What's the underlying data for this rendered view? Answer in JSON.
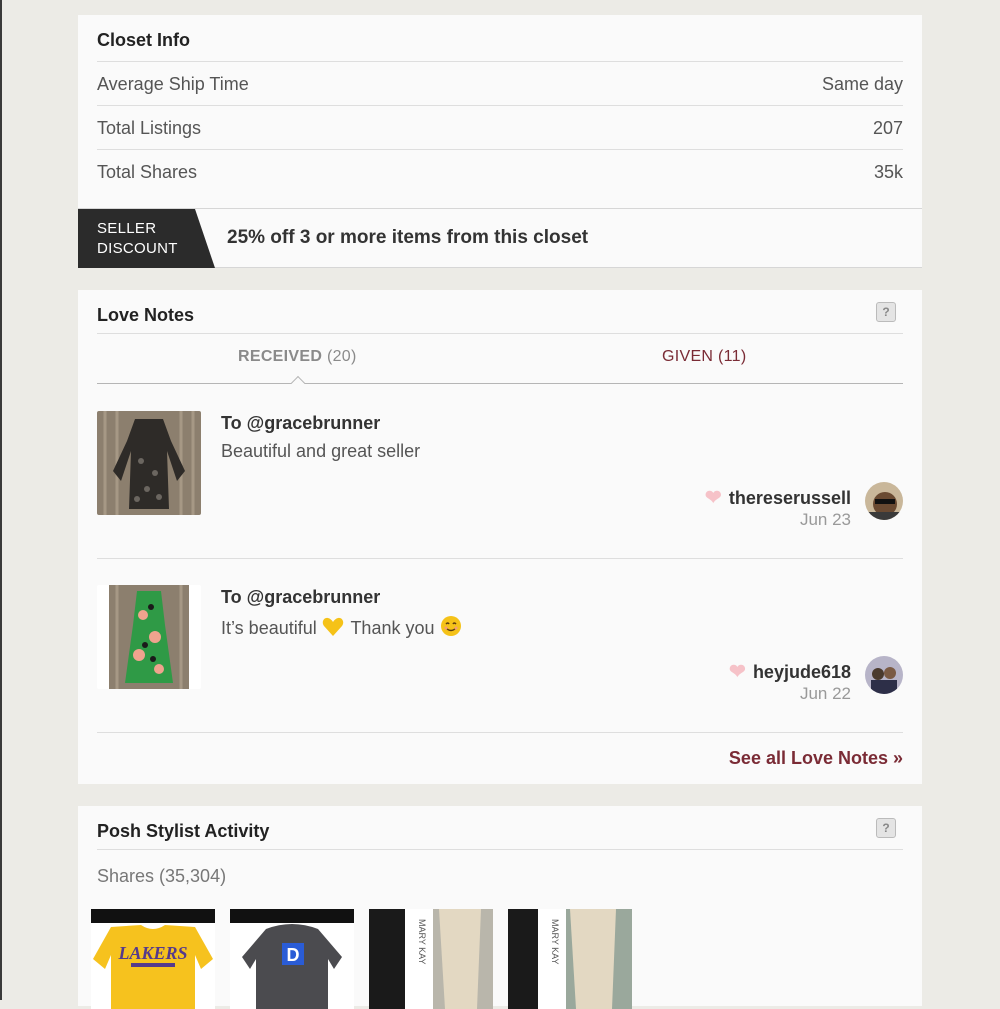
{
  "closet_info": {
    "title": "Closet Info",
    "rows": [
      {
        "label": "Average Ship Time",
        "value": "Same day"
      },
      {
        "label": "Total Listings",
        "value": "207"
      },
      {
        "label": "Total Shares",
        "value": "35k"
      }
    ],
    "discount_badge_line1": "SELLER",
    "discount_badge_line2": "DISCOUNT",
    "discount_text": "25% off 3 or more items from this closet"
  },
  "love_notes": {
    "title": "Love Notes",
    "help_label": "?",
    "tab_received_label": "RECEIVED",
    "tab_received_count": "(20)",
    "tab_given_label": "GIVEN (11)",
    "notes": [
      {
        "to": "To @gracebrunner",
        "message": "Beautiful and great seller",
        "user": "thereserussell",
        "date": "Jun 23"
      },
      {
        "to": "To @gracebrunner",
        "message_part1": "It’s beautiful",
        "message_part2": "Thank you",
        "user": "heyjude618",
        "date": "Jun 22"
      }
    ],
    "see_all": "See all Love Notes »"
  },
  "stylist": {
    "title": "Posh Stylist Activity",
    "help_label": "?",
    "shares_label": "Shares (35,304)",
    "thumbs": [
      "Lakers yellow long-sleeve shirt",
      "Duke gray hoodie",
      "Mary Kay product",
      "Mary Kay product"
    ]
  },
  "colors": {
    "accent": "#7a2b35",
    "heart": "#f6c2c8",
    "badge_bg": "#2b2b2b"
  },
  "icons": {
    "heart": "heart-icon",
    "help": "help-icon"
  }
}
